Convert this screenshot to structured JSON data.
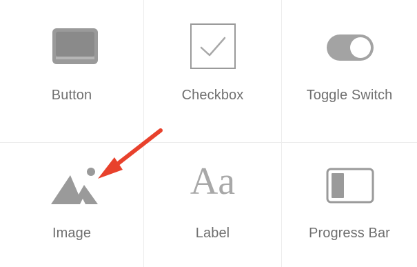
{
  "components": [
    {
      "label": "Button",
      "icon": "button-icon"
    },
    {
      "label": "Checkbox",
      "icon": "checkbox-icon"
    },
    {
      "label": "Toggle Switch",
      "icon": "toggle-switch-icon"
    },
    {
      "label": "Image",
      "icon": "image-icon"
    },
    {
      "label": "Label",
      "icon": "label-icon"
    },
    {
      "label": "Progress Bar",
      "icon": "progress-bar-icon"
    }
  ],
  "label_icon_glyph": "Aa",
  "colors": {
    "icon_gray": "#9a9a9a",
    "label_gray": "#6f6f6f",
    "grid_line": "#ececec",
    "annotation_arrow": "#e8412c"
  }
}
